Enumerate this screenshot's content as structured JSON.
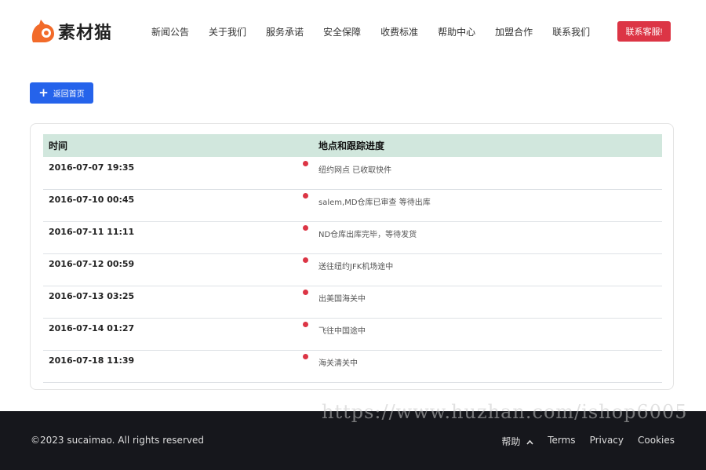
{
  "header": {
    "logo_text": "素材猫",
    "nav": [
      "新闻公告",
      "关于我们",
      "服务承诺",
      "安全保障",
      "收费标准",
      "帮助中心",
      "加盟合作",
      "联系我们"
    ],
    "contact_label": "联系客服!"
  },
  "back_button": {
    "icon": "plus-icon",
    "label": "返回首页"
  },
  "table": {
    "headers": {
      "time": "时间",
      "progress": "地点和跟踪进度"
    },
    "rows": [
      {
        "time": "2016-07-07 19:35",
        "desc": "纽约网点 已收取快件"
      },
      {
        "time": "2016-07-10 00:45",
        "desc": "salem,MD仓库已审查 等待出库"
      },
      {
        "time": "2016-07-11 11:11",
        "desc": "ND仓库出库完毕，等待发货"
      },
      {
        "time": "2016-07-12 00:59",
        "desc": "送往纽约JFK机场途中"
      },
      {
        "time": "2016-07-13 03:25",
        "desc": "出美国海关中"
      },
      {
        "time": "2016-07-14 01:27",
        "desc": "飞往中国途中"
      },
      {
        "time": "2016-07-18 11:39",
        "desc": "海关清关中"
      }
    ],
    "status_color": "#dc3545",
    "header_bg": "#d1e7dd"
  },
  "footer": {
    "copyright": "©2023 sucaimao. All rights reserved",
    "help_label": "帮助",
    "help_icon": "chevron-up-icon",
    "terms": "Terms",
    "privacy": "Privacy",
    "cookies": "Cookies"
  },
  "watermark": "https://www.huzhan.com/ishop6005",
  "colors": {
    "accent": "#2563eb",
    "brand": "#f26b2a",
    "danger": "#dc3545",
    "footer_bg": "#16171c"
  }
}
